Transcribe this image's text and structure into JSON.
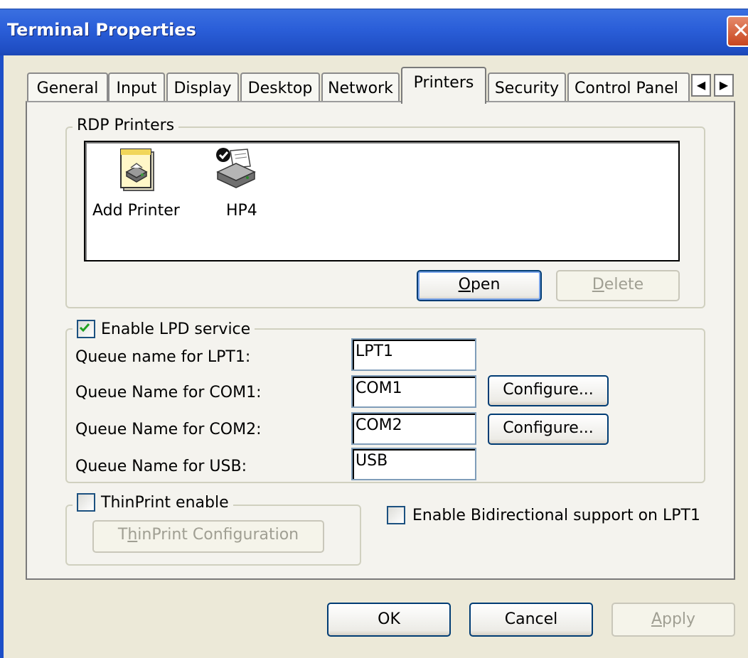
{
  "window": {
    "title": "Terminal Properties",
    "close_glyph": "✕"
  },
  "tabs": [
    {
      "label": "General"
    },
    {
      "label": "Input"
    },
    {
      "label": "Display"
    },
    {
      "label": "Desktop"
    },
    {
      "label": "Network"
    },
    {
      "label": "Printers",
      "active": true
    },
    {
      "label": "Security"
    },
    {
      "label": "Control Panel"
    }
  ],
  "tab_scroll": {
    "left": "◀",
    "right": "▶"
  },
  "rdp_printers": {
    "group_label": "RDP Printers",
    "items": [
      {
        "label": "Add Printer",
        "icon": "add-printer-icon"
      },
      {
        "label": "HP4",
        "icon": "default-printer-icon"
      }
    ],
    "open_button": {
      "accel": "O",
      "rest": "pen"
    },
    "delete_button": {
      "accel": "D",
      "rest": "elete"
    }
  },
  "lpd": {
    "checkbox_label": "Enable LPD service",
    "checked": true,
    "rows": [
      {
        "label": "Queue name for LPT1:",
        "value": "LPT1",
        "configure": ""
      },
      {
        "label": "Queue Name for COM1:",
        "value": "COM1",
        "configure": "Configure..."
      },
      {
        "label": "Queue Name for COM2:",
        "value": "COM2",
        "configure": "Configure..."
      },
      {
        "label": "Queue Name for USB:",
        "value": "USB",
        "configure": ""
      }
    ]
  },
  "thinprint": {
    "checkbox_label": "ThinPrint enable",
    "checked": false,
    "button": {
      "pre": "T",
      "accel": "h",
      "rest": "inPrint Configuration"
    }
  },
  "bidirectional": {
    "label": "Enable Bidirectional support on LPT1",
    "checked": false
  },
  "footer": {
    "ok": "OK",
    "cancel": "Cancel",
    "apply": {
      "accel": "A",
      "rest": "pply"
    }
  },
  "colors": {
    "title_bar": "#2b5fd9",
    "face": "#ece9d8",
    "panel": "#f4f3ee",
    "check": "#21a121"
  }
}
